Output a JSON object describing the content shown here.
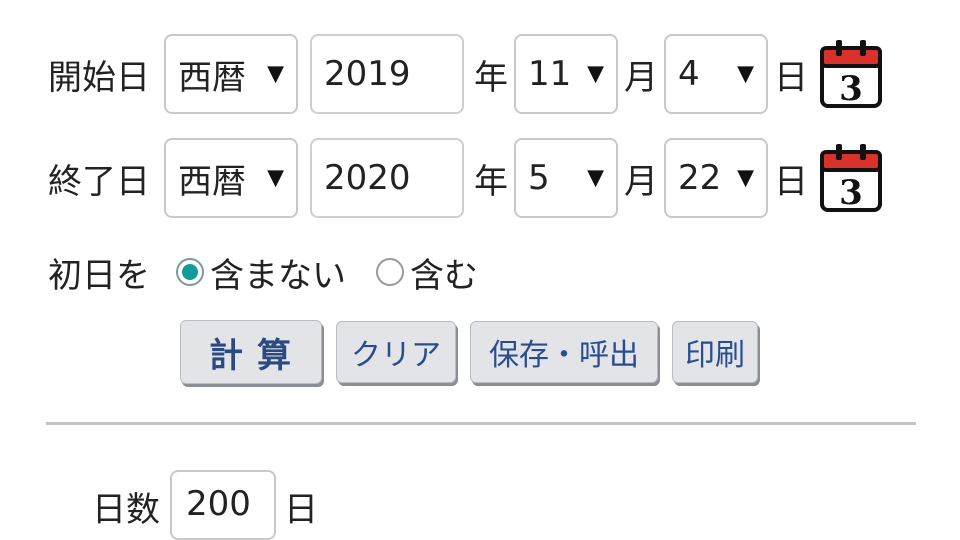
{
  "start": {
    "label": "開始日",
    "era": "西暦",
    "year": "2019",
    "year_unit": "年",
    "month": "11",
    "month_unit": "月",
    "day": "4",
    "day_unit": "日",
    "calendar_icon": "calendar-icon",
    "calendar_day": "3"
  },
  "end": {
    "label": "終了日",
    "era": "西暦",
    "year": "2020",
    "year_unit": "年",
    "month": "5",
    "month_unit": "月",
    "day": "22",
    "day_unit": "日",
    "calendar_icon": "calendar-icon",
    "calendar_day": "3"
  },
  "first_day": {
    "label": "初日を",
    "options": [
      {
        "label": "含まない",
        "selected": true
      },
      {
        "label": "含む",
        "selected": false
      }
    ]
  },
  "buttons": {
    "calculate": "計算",
    "clear": "クリア",
    "save_load": "保存・呼出",
    "print": "印刷"
  },
  "result": {
    "label": "日数",
    "value": "200",
    "unit": "日"
  },
  "colors": {
    "radio_selected": "#139b9b",
    "button_text": "#2a4d8e",
    "button_bg": "#e2e4e8",
    "calendar_red": "#d9312b"
  }
}
